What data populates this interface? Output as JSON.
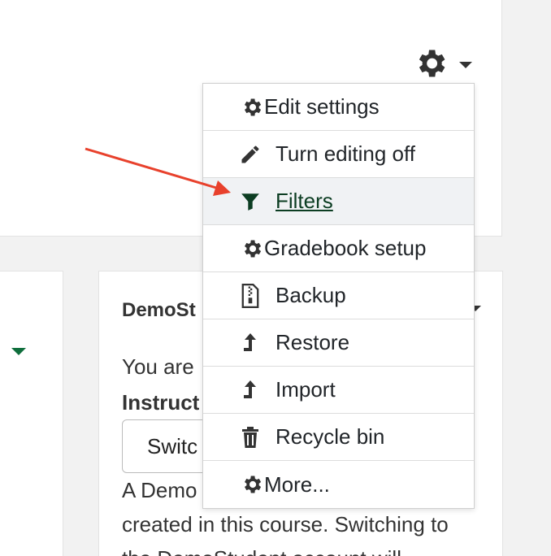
{
  "gear_menu": {
    "trigger_icon": "gear-icon",
    "items": [
      {
        "label": "Edit settings",
        "icon": "gear-icon"
      },
      {
        "label": "Turn editing off",
        "icon": "pencil-icon"
      },
      {
        "label": "Filters",
        "icon": "filter-icon",
        "active": true
      },
      {
        "label": "Gradebook setup",
        "icon": "gear-icon"
      },
      {
        "label": "Backup",
        "icon": "archive-icon"
      },
      {
        "label": "Restore",
        "icon": "upload-arrow-icon"
      },
      {
        "label": "Import",
        "icon": "upload-arrow-icon"
      },
      {
        "label": "Recycle bin",
        "icon": "trash-icon"
      },
      {
        "label": "More...",
        "icon": "gear-icon"
      }
    ]
  },
  "demo_block": {
    "title": "DemoSt",
    "line1": "You are",
    "line2": "Instruct",
    "switch_button": "Switc",
    "para_line1": "A Demo",
    "para_line2": "created in this course. Switching to",
    "para_line3": "the DemoStudent account will"
  },
  "colors": {
    "accent_green": "#0f6e3c",
    "annotation_arrow": "#e8412c",
    "active_link": "#0c3d22"
  }
}
